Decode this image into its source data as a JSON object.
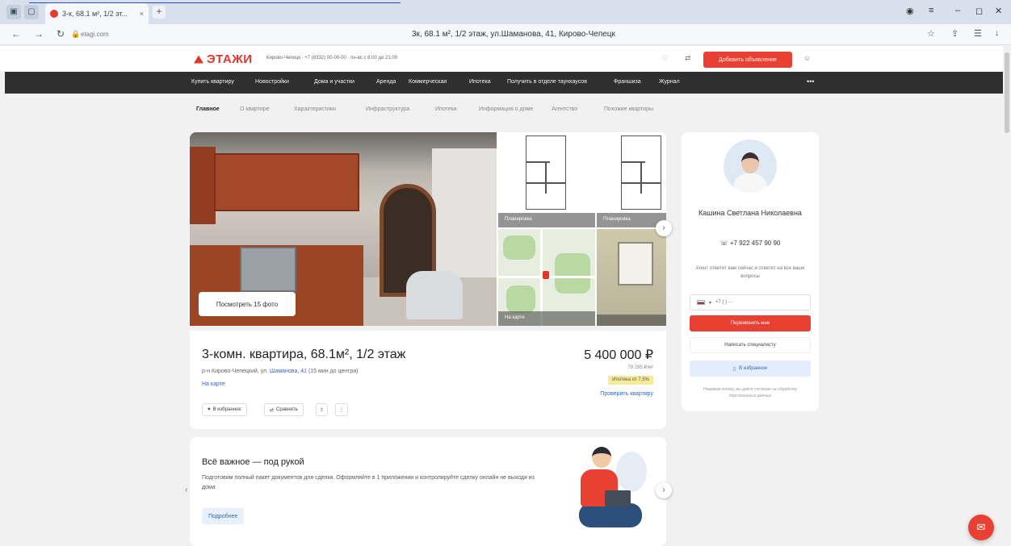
{
  "browser": {
    "tab_title": "3-к, 68.1 м², 1/2 эт...",
    "tab_close": "×",
    "new_tab": "+",
    "url_host": "etagi.com",
    "page_title": "3к, 68.1 м², 1/2 этаж, ул.Шаманова, 41, Кирово-Чепецк"
  },
  "header": {
    "logo": "ЭТАЖИ",
    "info": "Кирово-Чепецк · +7 (8332) 00-00-00 · пн-вс с 8:00 до 21:00",
    "add_button": "Добавить объявление"
  },
  "nav": {
    "items": [
      "Купить квартиру",
      "Новостройки",
      "Дома и участки",
      "Аренда",
      "Коммерческая",
      "Ипотека",
      "Получить в отделе таунхаусов",
      "Франшиза",
      "Журнал"
    ],
    "more": "•••"
  },
  "subtabs": [
    "Главное",
    "О квартире",
    "Характеристики",
    "Инфраструктура",
    "Ипотека",
    "Информация о доме",
    "Агентство",
    "Похожие квартиры"
  ],
  "gallery": {
    "show_all": "Посмотреть 15 фото",
    "plan_caption": "Планировка",
    "plan2_caption": "Планировка",
    "map_caption": "На карте"
  },
  "listing": {
    "title": "3-комн. квартира, 68.1м², 1/2 этаж",
    "address_prefix": "р-н Кирово-Чепецкий, ул. ",
    "address_street": "Шаманова, 41",
    "address_suffix": " (15 мин до центра)",
    "on_map": "На карте",
    "chips": [
      "В избранное",
      "Сравнить"
    ],
    "price": "5 400 000 ₽",
    "price_sub": "79 295 ₽/м²",
    "mortgage_tag": "Ипотека от 7,5%",
    "check_link": "Проверить квартиру"
  },
  "promo": {
    "title": "Всё важное — под рукой",
    "text": "Подготовим полный пакет документов для сделки. Оформляйте в 1 приложении и контролируйте сделку онлайн не выходя из дома",
    "button": "Подробнее"
  },
  "agent": {
    "name": "Кашина Светлана Николаевна",
    "phone": "+7 922 457 90 90",
    "note": "Агент ответит вам сейчас и ответит на все ваши вопросы",
    "phone_placeholder": "+7 (   )   -  -  ",
    "call_button": "Перезвонить мне",
    "write_button": "Написать специалисту",
    "favorite_button": "В избранное",
    "disclaimer": "Нажимая кнопку, вы даёте согласие на обработку персональных данных"
  },
  "colors": {
    "brand": "#e3362b",
    "nav_bg": "#2f2f2f",
    "link": "#2f68c7"
  }
}
